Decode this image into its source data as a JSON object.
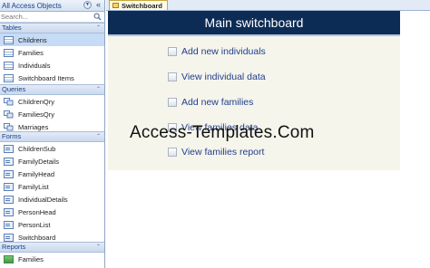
{
  "nav": {
    "title": "All Access Objects",
    "search_placeholder": "Search...",
    "groups": {
      "tables": {
        "label": "Tables",
        "items": [
          "Childrens",
          "Families",
          "Individuals",
          "Switchboard Items"
        ]
      },
      "queries": {
        "label": "Queries",
        "items": [
          "ChildrenQry",
          "FamiliesQry",
          "Marriages"
        ]
      },
      "forms": {
        "label": "Forms",
        "items": [
          "ChildrenSub",
          "FamilyDetails",
          "FamilyHead",
          "FamilyList",
          "IndividualDetails",
          "PersonHead",
          "PersonList",
          "Switchboard"
        ]
      },
      "reports": {
        "label": "Reports",
        "items": [
          "Families"
        ]
      }
    }
  },
  "document_tab": {
    "label": "Switchboard"
  },
  "switchboard": {
    "title": "Main switchboard",
    "items": [
      "Add new individuals",
      "View individual data",
      "Add new families",
      "View families data",
      "View families report"
    ]
  },
  "watermark": "Access-Templates.Com",
  "colors": {
    "header_bg": "#0d2c55",
    "body_bg": "#f5f5ec",
    "link_text": "#223e8c"
  }
}
